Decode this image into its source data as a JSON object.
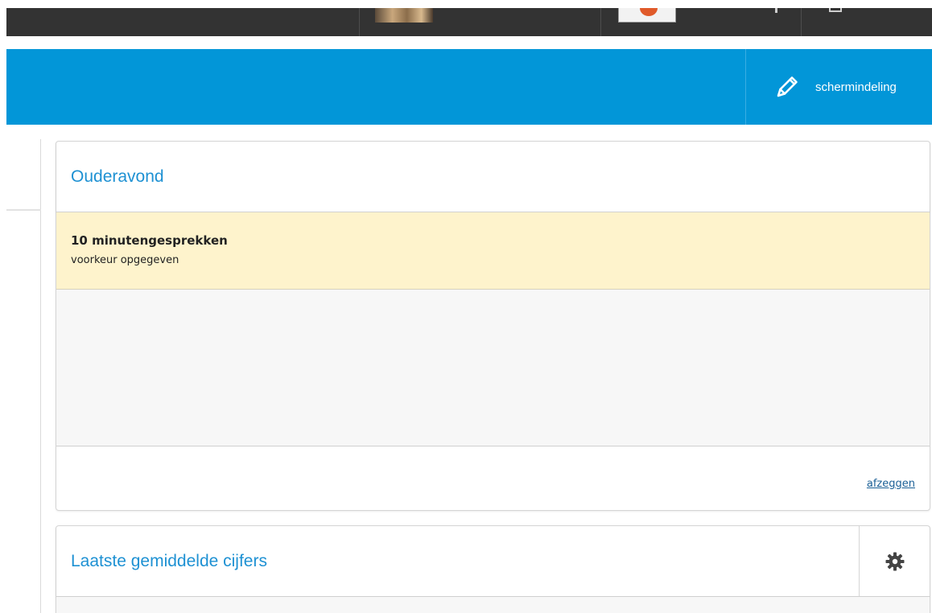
{
  "header": {
    "layout_button_label": "schermindeling"
  },
  "icons": {
    "layout": "pencil-icon",
    "settings": "gear-icon"
  },
  "colors": {
    "topbar": "#333333",
    "header": "#0296d8",
    "widget_title": "#1e91d3",
    "notice_background": "#fef3cc",
    "link": "#1a5f96"
  },
  "widgets": {
    "parent_evening": {
      "title": "Ouderavond",
      "notice_title": "10 minutengesprekken",
      "notice_subtitle": "voorkeur opgegeven",
      "cancel_label": "afzeggen"
    },
    "latest_grades": {
      "title": "Laatste gemiddelde cijfers"
    }
  }
}
